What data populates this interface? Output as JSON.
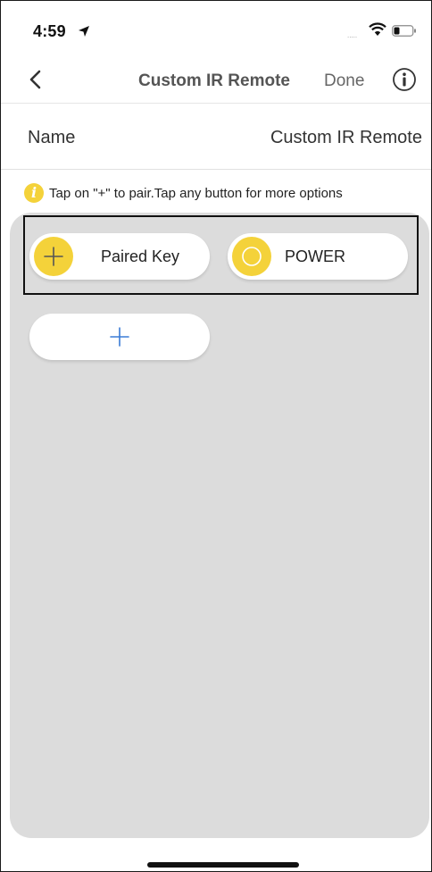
{
  "status_bar": {
    "time": "4:59",
    "signal_dots": "....."
  },
  "nav": {
    "title": "Custom IR Remote",
    "done_label": "Done"
  },
  "name_row": {
    "label": "Name",
    "value": "Custom IR Remote"
  },
  "hint": {
    "icon_glyph": "i",
    "text": "Tap on \"+\" to pair.Tap any button for more options"
  },
  "keys": [
    {
      "label": "Paired Key",
      "icon": "plus-icon"
    },
    {
      "label": "POWER",
      "icon": "circle-icon"
    }
  ],
  "add_key": {
    "icon": "plus-icon"
  },
  "colors": {
    "accent_yellow": "#f4d23a",
    "panel_gray": "#dcdcdc",
    "add_plus_blue": "#3a7bd5"
  }
}
